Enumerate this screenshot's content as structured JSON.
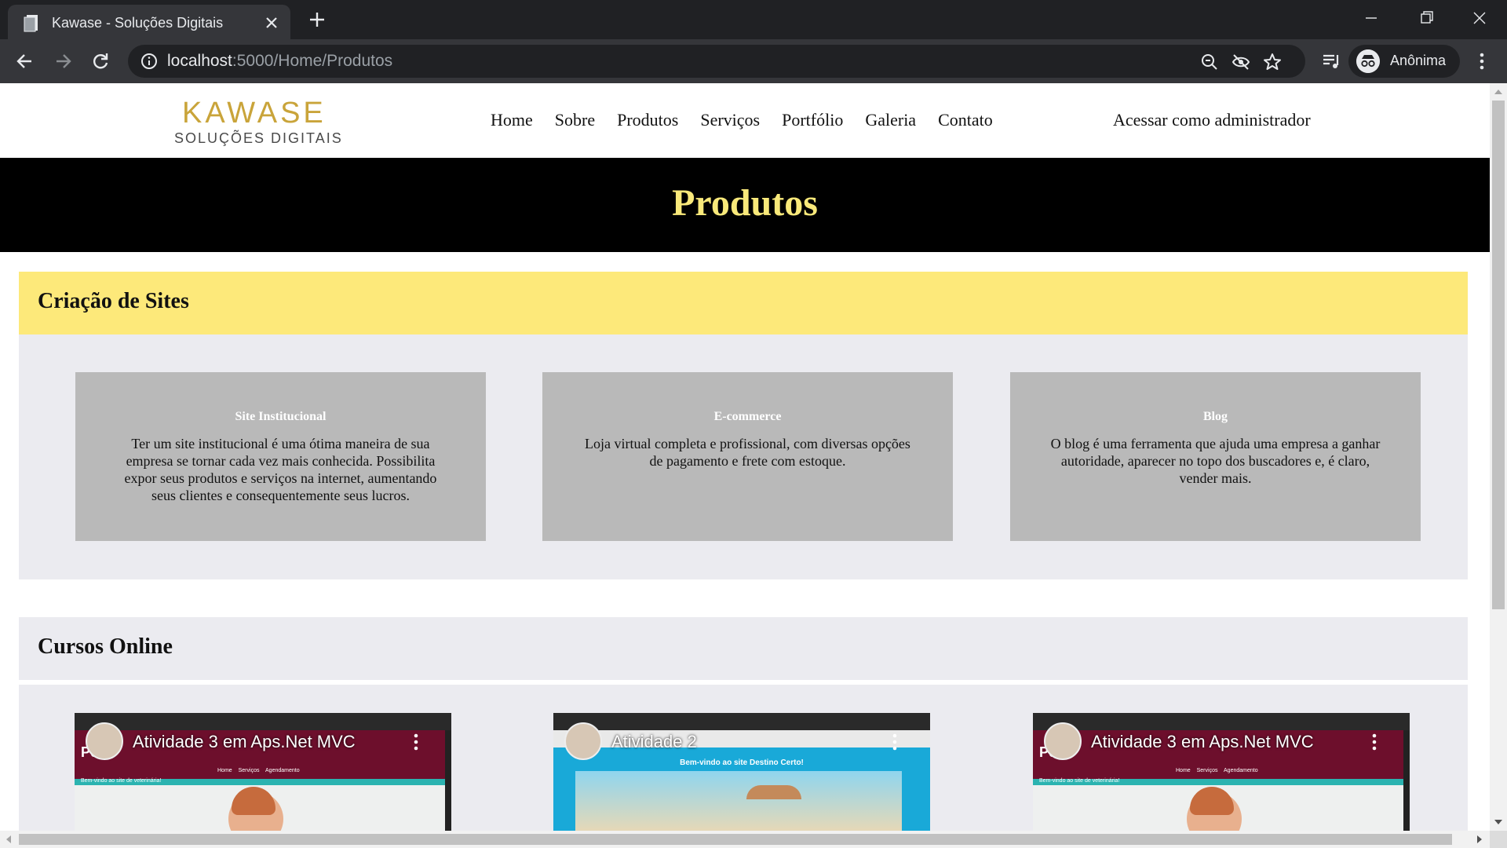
{
  "browser": {
    "tab_title": "Kawase - Soluções Digitais",
    "url_host": "localhost",
    "url_rest": ":5000/Home/Produtos",
    "profile_name": "Anônima"
  },
  "site": {
    "logo_main": "KAWASE",
    "logo_sub": "SOLUÇÕES DIGITAIS",
    "nav": [
      "Home",
      "Sobre",
      "Produtos",
      "Serviços",
      "Portfólio",
      "Galeria",
      "Contato"
    ],
    "admin_link": "Acessar como administrador"
  },
  "banner": {
    "title": "Produtos"
  },
  "sections": {
    "sites": {
      "title": "Criação de Sites",
      "cards": [
        {
          "title": "Site Institucional",
          "text": "Ter um site institucional é uma ótima maneira de sua empresa se tornar cada vez mais conhecida. Possibilita expor seus produtos e serviços na internet, aumentando seus clientes e consequentemente seus lucros."
        },
        {
          "title": "E-commerce",
          "text": "Loja virtual completa e profissional, com diversas opções de pagamento e frete com estoque."
        },
        {
          "title": "Blog",
          "text": "O blog é uma ferramenta que ajuda uma empresa a ganhar autoridade, aparecer no topo dos buscadores e, é claro, vender mais."
        }
      ]
    },
    "courses": {
      "title": "Cursos Online",
      "videos": [
        {
          "title": "Atividade 3 em Aps.Net MVC",
          "brand": "Pet",
          "menu": "Home Serviços Agendamento",
          "strip": "Bem-vindo ao site de veterinária!"
        },
        {
          "title": "Atividade 2",
          "welcome": "Bem-vindo ao site Destino Certo!"
        },
        {
          "title": "Atividade 3 em Aps.Net MVC",
          "brand": "Pet",
          "menu": "Home Serviços Agendamento",
          "strip": "Bem-vindo ao site de veterinária!"
        }
      ]
    }
  },
  "colors": {
    "banner_title": "#f9e97a",
    "section_highlight": "#fde97a",
    "card_bg": "#b9b9b9",
    "logo_gold": "#c9a43a"
  },
  "icons": [
    "tab-favicon-icon",
    "close-icon",
    "plus-icon",
    "minimize-icon",
    "restore-icon",
    "back-icon",
    "forward-icon",
    "reload-icon",
    "info-icon",
    "zoom-icon",
    "eye-off-icon",
    "star-icon",
    "media-icon",
    "incognito-icon",
    "menu-icon"
  ]
}
